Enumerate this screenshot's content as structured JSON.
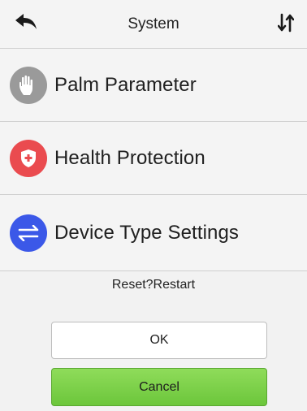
{
  "header": {
    "title": "System",
    "back_icon": "back-arrow-icon",
    "sort_icon": "sort-arrows-icon"
  },
  "menu": {
    "items": [
      {
        "label": "Palm  Parameter",
        "icon": "palm-icon",
        "icon_color": "#9a9a9a"
      },
      {
        "label": "Health Protection",
        "icon": "shield-icon",
        "icon_color": "#ea4b4f"
      },
      {
        "label": "Device Type Settings",
        "icon": "transfer-arrows-icon",
        "icon_color": "#3b58e8"
      }
    ]
  },
  "dialog": {
    "message": "Reset?Restart",
    "ok_label": "OK",
    "cancel_label": "Cancel",
    "cancel_color": "#79cf46"
  }
}
